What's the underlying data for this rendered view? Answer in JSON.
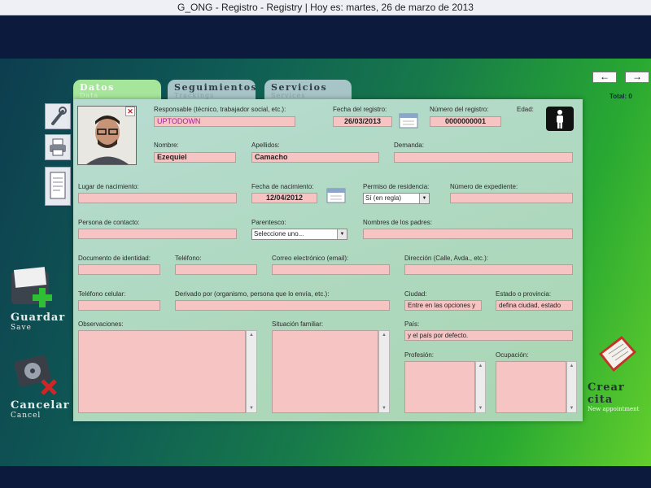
{
  "window_title": "G_ONG - Registro - Registry   |   Hoy es: martes, 26 de marzo de 2013",
  "tabs": [
    {
      "label": "Datos",
      "sub": "Data",
      "active": true
    },
    {
      "label": "Seguimientos",
      "sub": "Trackings",
      "active": false
    },
    {
      "label": "Servicios",
      "sub": "Services",
      "active": false
    }
  ],
  "nav": {
    "prev_icon": "arrow-left",
    "next_icon": "arrow-right",
    "total_label": "Total: 0"
  },
  "actions": {
    "save_label": "Guardar",
    "save_sub": "Save",
    "cancel_label": "Cancelar",
    "cancel_sub": "Cancel",
    "appointment_label": "Crear cita",
    "appointment_sub": "New appointment"
  },
  "photo": {
    "remove_symbol": "✕"
  },
  "fields": {
    "responsable": {
      "label": "Responsable (técnico, trabajador social, etc.):",
      "value": "UPTODOWN"
    },
    "fecha_registro": {
      "label": "Fecha del registro:",
      "value": "26/03/2013"
    },
    "numero_registro": {
      "label": "Número del registro:",
      "value": "0000000001"
    },
    "edad": {
      "label": "Edad:",
      "value": ""
    },
    "nombre": {
      "label": "Nombre:",
      "value": "Ezequiel"
    },
    "apellidos": {
      "label": "Apellidos:",
      "value": "Camacho"
    },
    "demanda": {
      "label": "Demanda:",
      "value": ""
    },
    "lugar_nacimiento": {
      "label": "Lugar de nacimiento:",
      "value": ""
    },
    "fecha_nacimiento": {
      "label": "Fecha de nacimiento:",
      "value": "12/04/2012"
    },
    "permiso_residencia": {
      "label": "Permiso de residencia:",
      "value": "Sí (en regla)"
    },
    "numero_expediente": {
      "label": "Número de expediente:",
      "value": ""
    },
    "persona_contacto": {
      "label": "Persona de contacto:",
      "value": ""
    },
    "parentesco": {
      "label": "Parentesco:",
      "value": "Seleccione uno..."
    },
    "nombres_padres": {
      "label": "Nombres de los padres:",
      "value": ""
    },
    "documento_identidad": {
      "label": "Documento de identidad:",
      "value": ""
    },
    "telefono": {
      "label": "Teléfono:",
      "value": ""
    },
    "correo": {
      "label": "Correo electrónico (email):",
      "value": ""
    },
    "direccion": {
      "label": "Dirección (Calle, Avda., etc.):",
      "value": ""
    },
    "telefono_celular": {
      "label": "Teléfono celular:",
      "value": ""
    },
    "derivado_por": {
      "label": "Derivado por (organismo, persona que lo envía, etc.):",
      "value": ""
    },
    "ciudad": {
      "label": "Ciudad:",
      "value": "Entre en las opciones y"
    },
    "estado_provincia": {
      "label": "Estado o provincia:",
      "value": "defina ciudad, estado"
    },
    "observaciones": {
      "label": "Observaciones:",
      "value": ""
    },
    "situacion_familiar": {
      "label": "Situación familiar:",
      "value": ""
    },
    "pais": {
      "label": "País:",
      "value": "y el país por defecto."
    },
    "profesion": {
      "label": "Profesión:",
      "value": ""
    },
    "ocupacion": {
      "label": "Ocupación:",
      "value": ""
    }
  },
  "colors": {
    "field_bg": "#f7c4c4",
    "panel_bg": "#aed8bd",
    "tab_active": "#a6e69a",
    "tab_inactive": "#a7c4c7",
    "value_text_magenta": "#a0208e"
  }
}
